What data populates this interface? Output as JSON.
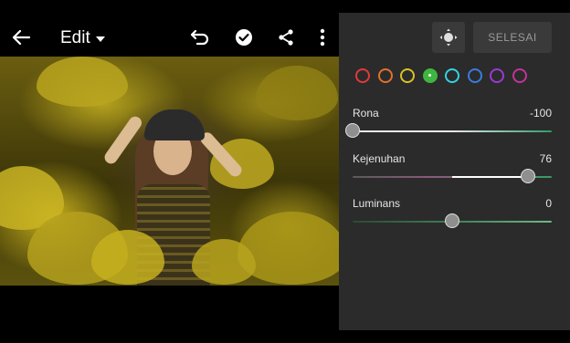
{
  "toolbar": {
    "title": "Edit",
    "icons": [
      "back-arrow-icon",
      "caret-down-icon",
      "undo-icon",
      "check-circle-icon",
      "share-icon",
      "more-vertical-icon"
    ]
  },
  "panel": {
    "done_label": "SELESAI",
    "target_icon": "target-adjust-icon",
    "swatches": [
      {
        "name": "red",
        "color": "#e03a3a"
      },
      {
        "name": "orange",
        "color": "#e0712c"
      },
      {
        "name": "yellow",
        "color": "#d8c323"
      },
      {
        "name": "green",
        "color": "#3fb63f",
        "selected": true
      },
      {
        "name": "aqua",
        "color": "#33d2e6"
      },
      {
        "name": "blue",
        "color": "#3a7be0"
      },
      {
        "name": "purple",
        "color": "#9a38d6"
      },
      {
        "name": "magenta",
        "color": "#c2339b"
      }
    ],
    "sliders": [
      {
        "label": "Rona",
        "value": "-100",
        "level": -100,
        "range": [
          -100,
          100
        ]
      },
      {
        "label": "Kejenuhan",
        "value": "76",
        "level": 76,
        "range": [
          -100,
          100
        ]
      },
      {
        "label": "Luminans",
        "value": "0",
        "level": 0,
        "range": [
          -100,
          100
        ]
      }
    ]
  }
}
